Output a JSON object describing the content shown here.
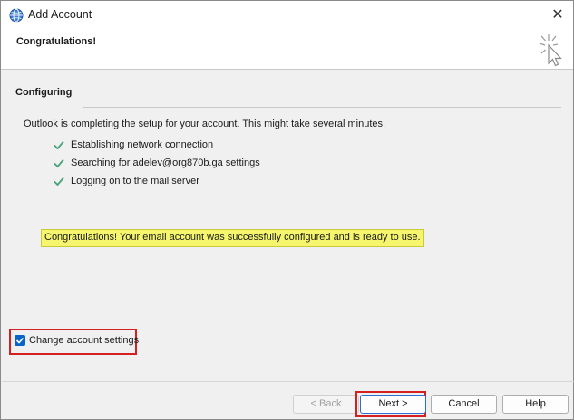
{
  "window": {
    "title": "Add Account",
    "close_glyph": "✕",
    "app_icon": "outlook-globe-icon"
  },
  "header": {
    "title": "Congratulations!",
    "art_icon": "cursor-click-icon"
  },
  "section": {
    "title": "Configuring"
  },
  "intro": "Outlook is completing the setup for your account. This might take several minutes.",
  "steps": [
    {
      "label": "Establishing network connection",
      "status": "done"
    },
    {
      "label": "Searching for adelev@org870b.ga settings",
      "status": "done"
    },
    {
      "label": "Logging on to the mail server",
      "status": "done"
    }
  ],
  "success_message": "Congratulations! Your email account was successfully configured and is ready to use.",
  "change_settings": {
    "label": "Change account settings",
    "checked": true
  },
  "buttons": {
    "back": "< Back",
    "next": "Next >",
    "cancel": "Cancel",
    "help": "Help"
  },
  "colors": {
    "check_green": "#4aa37a",
    "highlight_yellow": "#f5f56e",
    "annotation_red": "#d42020",
    "checkbox_blue": "#0a64c8"
  }
}
